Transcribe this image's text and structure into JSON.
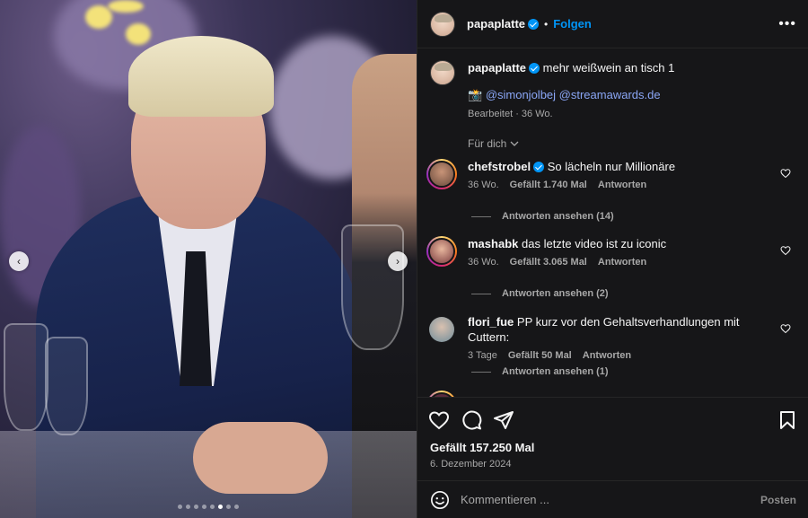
{
  "post": {
    "author": "papaplatte",
    "follow_label": "Folgen",
    "separator": "•",
    "more_label": "•••",
    "caption": "mehr weißwein an tisch 1",
    "mention_emoji": "📸",
    "mentions": [
      "@simonjolbej",
      "@streamawards.de"
    ],
    "caption_meta": "Bearbeitet · 36 Wo."
  },
  "comments_header": "Für dich",
  "comments": [
    {
      "user": "chefstrobel",
      "verified": true,
      "text": "So lächeln nur Millionäre",
      "age": "36 Wo.",
      "likes": "Gefällt 1.740 Mal",
      "reply": "Antworten",
      "view_replies": "Antworten ansehen (14)"
    },
    {
      "user": "mashabk",
      "verified": false,
      "text": "das letzte video ist zu iconic",
      "age": "36 Wo.",
      "likes": "Gefällt 3.065 Mal",
      "reply": "Antworten",
      "view_replies": "Antworten ansehen (2)"
    },
    {
      "user": "flori_fue",
      "verified": false,
      "text": "PP kurz vor den Gehaltsverhandlungen mit Cuttern:",
      "age": "3 Tage",
      "likes": "Gefällt 50 Mal",
      "reply": "Antworten",
      "view_replies": "Antworten ansehen (1)"
    }
  ],
  "engagement": {
    "likes": "Gefällt 157.250 Mal",
    "date": "6. Dezember 2024"
  },
  "comment_box": {
    "placeholder": "Kommentieren ...",
    "post_label": "Posten"
  },
  "carousel": {
    "prev": "‹",
    "next": "›",
    "total_slides": 8,
    "active_slide": 6
  },
  "colors": {
    "accent": "#0095f6",
    "link": "#8aa6f5",
    "panel_bg": "#161618"
  },
  "icons": [
    "heart-icon",
    "comment-icon",
    "share-icon",
    "bookmark-icon",
    "emoji-icon",
    "verified-icon",
    "more-icon"
  ]
}
